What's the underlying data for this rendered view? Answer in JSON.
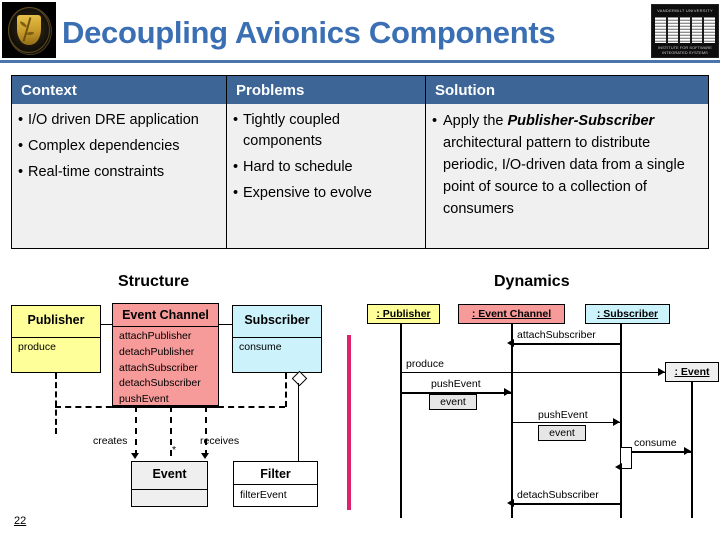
{
  "header": {
    "title": "Decoupling Avionics Components",
    "left_logo": "vanderbilt-seal",
    "right_logo": {
      "name": "isis-logo",
      "top_text": "VANDERBILT UNIVERSITY",
      "mark": "ISIS",
      "bottom_text_1": "INSTITUTE FOR SOFTWARE",
      "bottom_text_2": "INTEGRATED SYSTEMS"
    },
    "accent_color": "#3b6fb4"
  },
  "table": {
    "header_bg": "#3d6697",
    "body_bg": "#f0f0f0",
    "columns": [
      {
        "header": "Context",
        "bullets": [
          "I/O driven DRE application",
          "Complex dependencies",
          "Real-time constraints"
        ]
      },
      {
        "header": "Problems",
        "bullets": [
          "Tightly coupled components",
          "Hard to schedule",
          "Expensive to evolve"
        ]
      },
      {
        "header": "Solution",
        "bullets_rich": [
          {
            "pre": "Apply the ",
            "em": "Publisher-Subscriber",
            "post": " architectural pattern to distribute periodic, I/O-driven data from a single point of source to a collection of consumers"
          }
        ]
      }
    ]
  },
  "structure": {
    "title": "Structure",
    "classes": [
      {
        "name": "Publisher",
        "operations": [
          "produce"
        ],
        "color": "#ffff99"
      },
      {
        "name": "Event Channel",
        "operations": [
          "attachPublisher",
          "detachPublisher",
          "attachSubscriber",
          "detachSubscriber",
          "pushEvent"
        ],
        "color": "#f79a9a"
      },
      {
        "name": "Subscriber",
        "operations": [
          "consume"
        ],
        "color": "#ccf2fb"
      },
      {
        "name": "Event",
        "operations": [],
        "color": "#efefef"
      },
      {
        "name": "Filter",
        "operations": [
          "filterEvent"
        ],
        "color": "#ffffff"
      }
    ],
    "relations": [
      {
        "label": "creates"
      },
      {
        "label": "receives"
      },
      {
        "label": "*"
      }
    ]
  },
  "dynamics": {
    "title": "Dynamics",
    "lifelines": [
      {
        "label": ": Publisher",
        "color": "#ffff99"
      },
      {
        "label": ": Event Channel",
        "color": "#f79a9a"
      },
      {
        "label": ": Subscriber",
        "color": "#ccf2fb"
      },
      {
        "label": ": Event",
        "color": "#efefef"
      }
    ],
    "messages": [
      {
        "label": "attachSubscriber",
        "param": null
      },
      {
        "label": "produce",
        "param": null
      },
      {
        "label": "pushEvent",
        "param": "event"
      },
      {
        "label": "pushEvent",
        "param": "event"
      },
      {
        "label": "consume",
        "param": null
      },
      {
        "label": "detachSubscriber",
        "param": null
      }
    ]
  },
  "divider_color": "#e0216e",
  "page_number": "22"
}
